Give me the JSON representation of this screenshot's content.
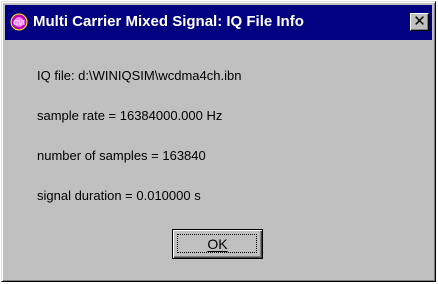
{
  "window": {
    "title": "Multi Carrier Mixed Signal: IQ File Info",
    "close_glyph": "✕",
    "icon_label": "CVI"
  },
  "info": {
    "iq_file": "IQ file: d:\\WINIQSIM\\wcdma4ch.ibn",
    "sample_rate": "sample rate = 16384000.000 Hz",
    "num_samples": "number of samples = 163840",
    "duration": "signal duration = 0.010000 s"
  },
  "buttons": {
    "ok_label": "OK"
  },
  "colors": {
    "titlebar": "#000080",
    "face": "#c0c0c0",
    "icon_accent": "#c000c0"
  }
}
